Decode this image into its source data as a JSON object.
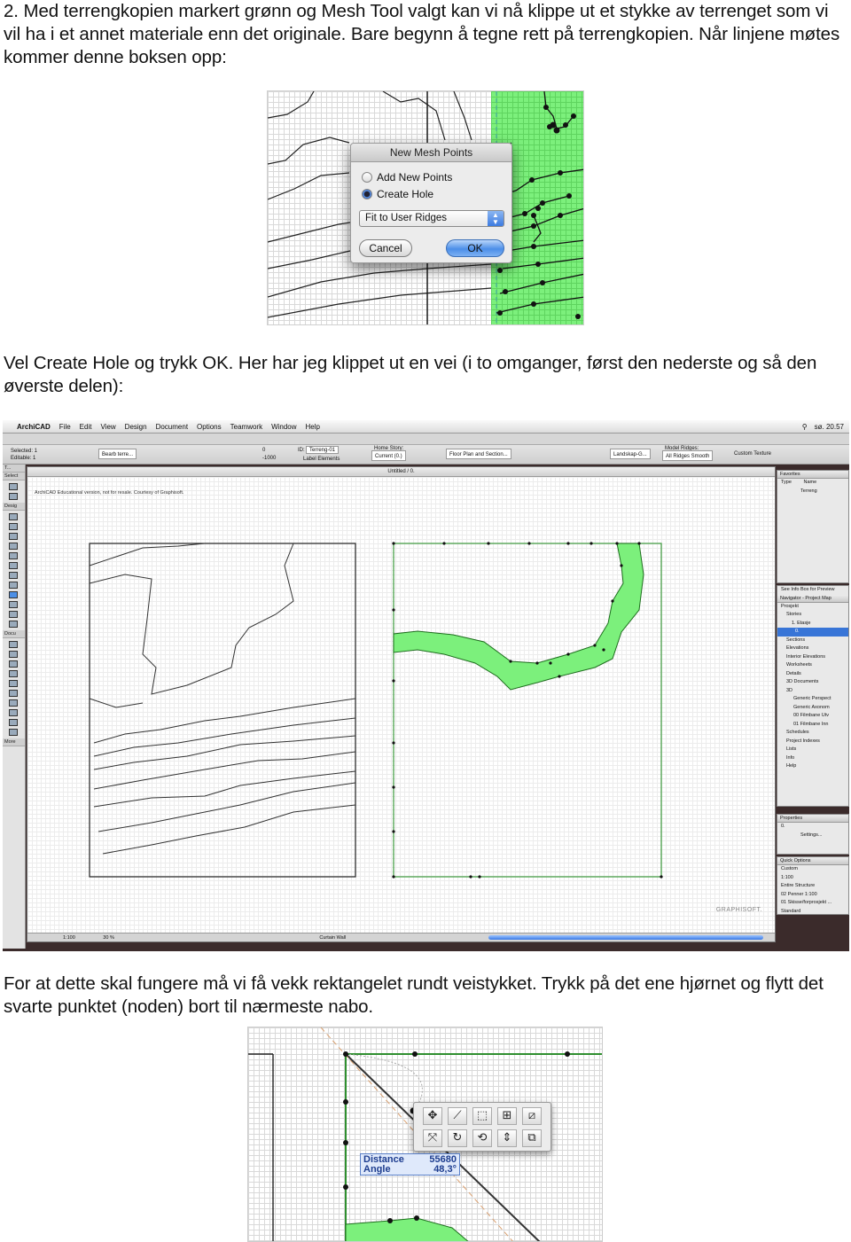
{
  "paragraphs": {
    "p1": "2. Med terrengkopien markert grønn og Mesh Tool valgt kan vi nå klippe ut et stykke av terrenget som vi vil ha i et annet materiale enn det originale. Bare begynn å tegne rett på terrengkopien. Når linjene møtes kommer denne boksen opp:",
    "p2": "Vel Create Hole og trykk OK. Her har jeg klippet ut en vei (i to omganger, først den nederste og så den øverste delen):",
    "p3": "For at dette skal fungere må vi få vekk rektangelet rundt veistykket. Trykk på det ene hjørnet og flytt det svarte punktet (noden) bort til nærmeste nabo."
  },
  "dialog": {
    "title": "New Mesh Points",
    "option_add": "Add New Points",
    "option_hole": "Create Hole",
    "selected_option": "Create Hole",
    "select_value": "Fit to User Ridges",
    "cancel": "Cancel",
    "ok": "OK"
  },
  "archicad": {
    "menu": [
      "ArchiCAD",
      "File",
      "Edit",
      "View",
      "Design",
      "Document",
      "Options",
      "Teamwork",
      "Window",
      "Help"
    ],
    "clock": "sø. 20.57",
    "infobox": {
      "selected": "Selected: 1",
      "editable": "Editable: 1",
      "layer": "Bearb terre...",
      "id_label": "ID:",
      "id_value": "Terreng-01",
      "zero": "0",
      "elev": "-1000",
      "label_elements": "Label Elements",
      "home_story_label": "Home Story:",
      "home_story": "Current (0.)",
      "floor_plan": "Floor Plan and Section...",
      "material": "Landskap-G...",
      "model_ridges_label": "Model Ridges:",
      "ridges": "All Ridges Smooth",
      "custom_texture": "Custom Texture"
    },
    "toolbox": {
      "header": "T...",
      "select": "Select",
      "design": "Desig",
      "document": "Docu",
      "more": "More"
    },
    "window_title": "Untitled / 0.",
    "watermark_note": "ArchiCAD Educational version, not for resale. Courtesy of Graphisoft.",
    "graphisoft": "GRAPHISOFT.",
    "status": {
      "scale": "1:100",
      "zoom": "30 %",
      "curtain_wall": "Curtain Wall"
    },
    "favorites": {
      "title": "Favorites",
      "col_type": "Type",
      "col_name": "Name",
      "item": "Terreng"
    },
    "infobox_preview": "See Info Box for Preview",
    "navigator": {
      "title": "Navigator - Project Map",
      "items": [
        "Prosjekt",
        "Stories",
        "1. Etasje",
        "0.",
        "Sections",
        "Elevations",
        "Interior Elevations",
        "Worksheets",
        "Details",
        "3D Documents",
        "3D",
        "Generic Perspect",
        "Generic Axonom",
        "00 Filmbane Utv",
        "01 Filmbane Inn",
        "Schedules",
        "Project Indexes",
        "Lists",
        "Info",
        "Help"
      ]
    },
    "properties": {
      "title": "Properties",
      "value": "0.",
      "settings": "Settings..."
    },
    "quick_options": {
      "title": "Quick Options",
      "items": [
        "Custom",
        "1:100",
        "Entire Structure",
        "02 Penner 1:100",
        "01 Skisse/forprosjekt ...",
        "Standard"
      ]
    }
  },
  "pet_palette": {
    "icons": [
      "move-icon",
      "drag-vertex-icon",
      "offset-icon",
      "add-node-icon",
      "mirror-icon",
      "drag-copy-icon",
      "rotate-icon",
      "rotate-copy-icon",
      "elevate-icon",
      "multiply-icon"
    ],
    "glyphs": [
      "✥",
      "⟋",
      "⬚",
      "⊞",
      "⧄",
      "⤧",
      "↻",
      "⟲",
      "⇕",
      "⧉"
    ]
  },
  "tracker": {
    "distance_label": "Distance",
    "distance_value": "55680",
    "angle_label": "Angle",
    "angle_value": "48,3°"
  },
  "colors": {
    "terrain_green": "#7cf07c",
    "mesh_line": "#2f8f2f",
    "ok_button": "#4b8ee8",
    "selection_blue": "#3875d7"
  }
}
